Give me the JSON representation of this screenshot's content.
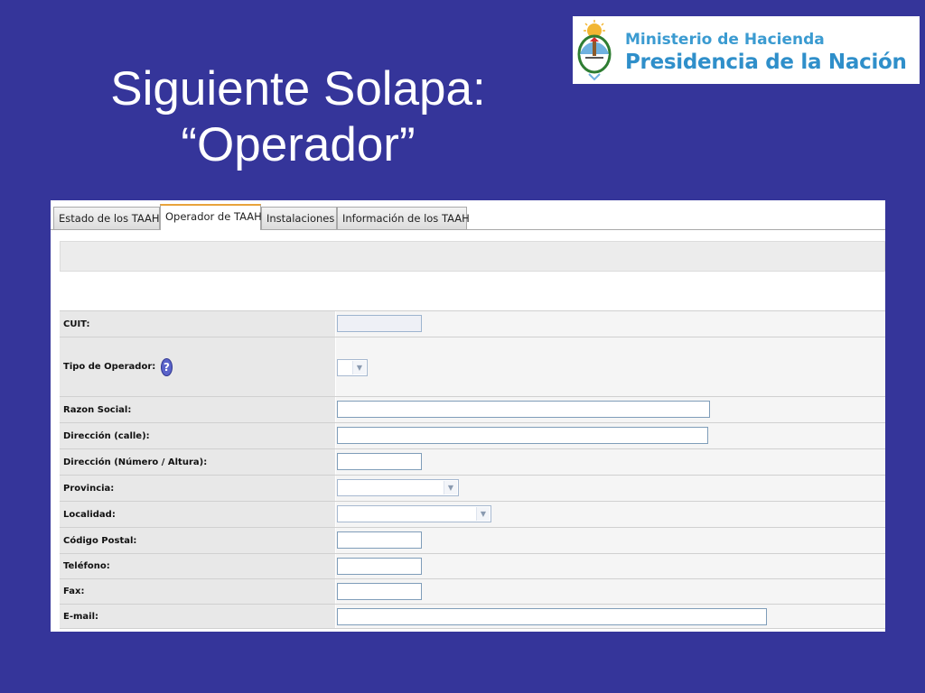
{
  "slide": {
    "title_line1": "Siguiente Solapa:",
    "title_line2": "“Operador”"
  },
  "logo": {
    "line1": "Ministerio de Hacienda",
    "line2": "Presidencia de la Nación"
  },
  "tabs": [
    {
      "label": "Estado de los TAAH",
      "active": false
    },
    {
      "label": "Operador de TAAH",
      "active": true
    },
    {
      "label": "Instalaciones",
      "active": false
    },
    {
      "label": "Información de los TAAH",
      "active": false
    }
  ],
  "form": {
    "cuit": {
      "label": "CUIT:",
      "value": ""
    },
    "tipo_operador": {
      "label": "Tipo de Operador:",
      "value": ""
    },
    "razon_social": {
      "label": "Razon Social:",
      "value": ""
    },
    "direccion_calle": {
      "label": "Dirección (calle):",
      "value": ""
    },
    "direccion_numero": {
      "label": "Dirección (Número / Altura):",
      "value": ""
    },
    "provincia": {
      "label": "Provincia:",
      "value": ""
    },
    "localidad": {
      "label": "Localidad:",
      "value": ""
    },
    "codigo_postal": {
      "label": "Código Postal:",
      "value": ""
    },
    "telefono": {
      "label": "Teléfono:",
      "value": ""
    },
    "fax": {
      "label": "Fax:",
      "value": ""
    },
    "email": {
      "label": "E-mail:",
      "value": ""
    }
  },
  "colors": {
    "slide_background": "#35359a",
    "active_tab_accent": "#e8a33b",
    "logo_text": "#2f8fca"
  }
}
